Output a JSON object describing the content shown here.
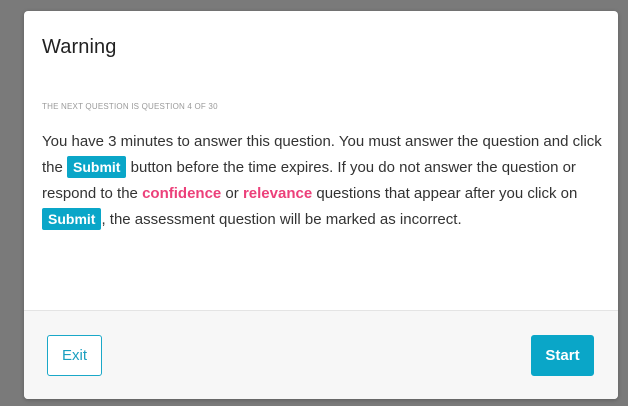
{
  "dialog": {
    "title": "Warning",
    "subtitle": "THE NEXT QUESTION IS QUESTION 4 OF 30",
    "message": {
      "part1": "You have 3 minutes to answer this question. You must answer the question and click the ",
      "chip1": "Submit",
      "part2": " button before the time expires. If you do not answer the question or respond to the ",
      "confidence": "confidence",
      "part3": " or ",
      "relevance": "relevance",
      "part4": " questions that appear after you click on ",
      "chip2": "Submit",
      "part5": ", the assessment question will be marked as incorrect."
    }
  },
  "footer": {
    "exit_label": "Exit",
    "start_label": "Start"
  },
  "colors": {
    "accent": "#0aa6c8",
    "highlight": "#ec407a"
  }
}
